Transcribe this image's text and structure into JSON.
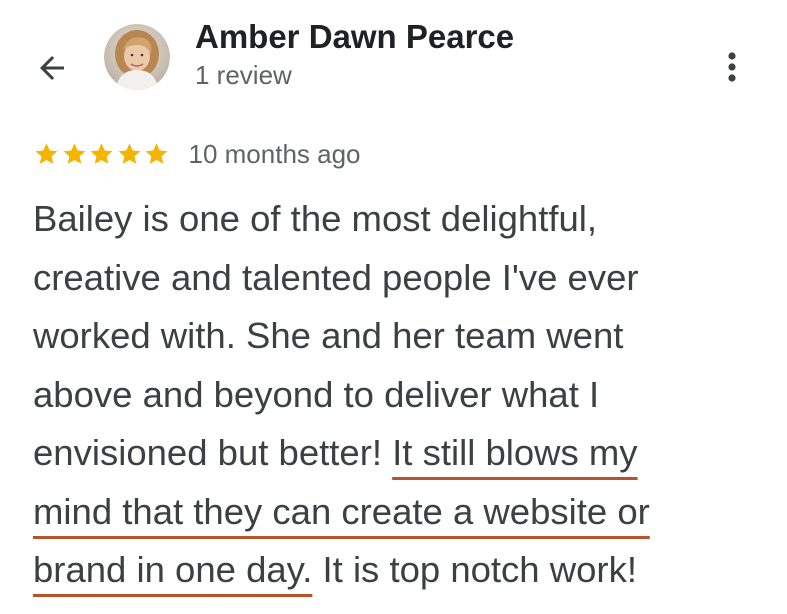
{
  "header": {
    "back_icon": "arrow-left-icon",
    "reviewer": {
      "name": "Amber Dawn Pearce",
      "meta": "1 review"
    },
    "more_icon": "more-vert-icon"
  },
  "review": {
    "rating": 5,
    "rating_max": 5,
    "star_color": "#f5b400",
    "date": "10 months ago",
    "lines": [
      {
        "pre": "Bailey is one of the most delightful,",
        "highlight": "",
        "post": ""
      },
      {
        "pre": "creative and talented people I've ever",
        "highlight": "",
        "post": ""
      },
      {
        "pre": "worked with. She and her team went",
        "highlight": "",
        "post": ""
      },
      {
        "pre": "above and beyond to deliver what I",
        "highlight": "",
        "post": ""
      },
      {
        "pre": "envisioned but better! ",
        "highlight": "It still blows my",
        "post": ""
      },
      {
        "pre": "",
        "highlight": "mind that they can create a website or",
        "post": ""
      },
      {
        "pre": "",
        "highlight": "brand in one day.",
        "post": " It is top notch work!"
      }
    ],
    "highlight_color": "#b5532b"
  }
}
